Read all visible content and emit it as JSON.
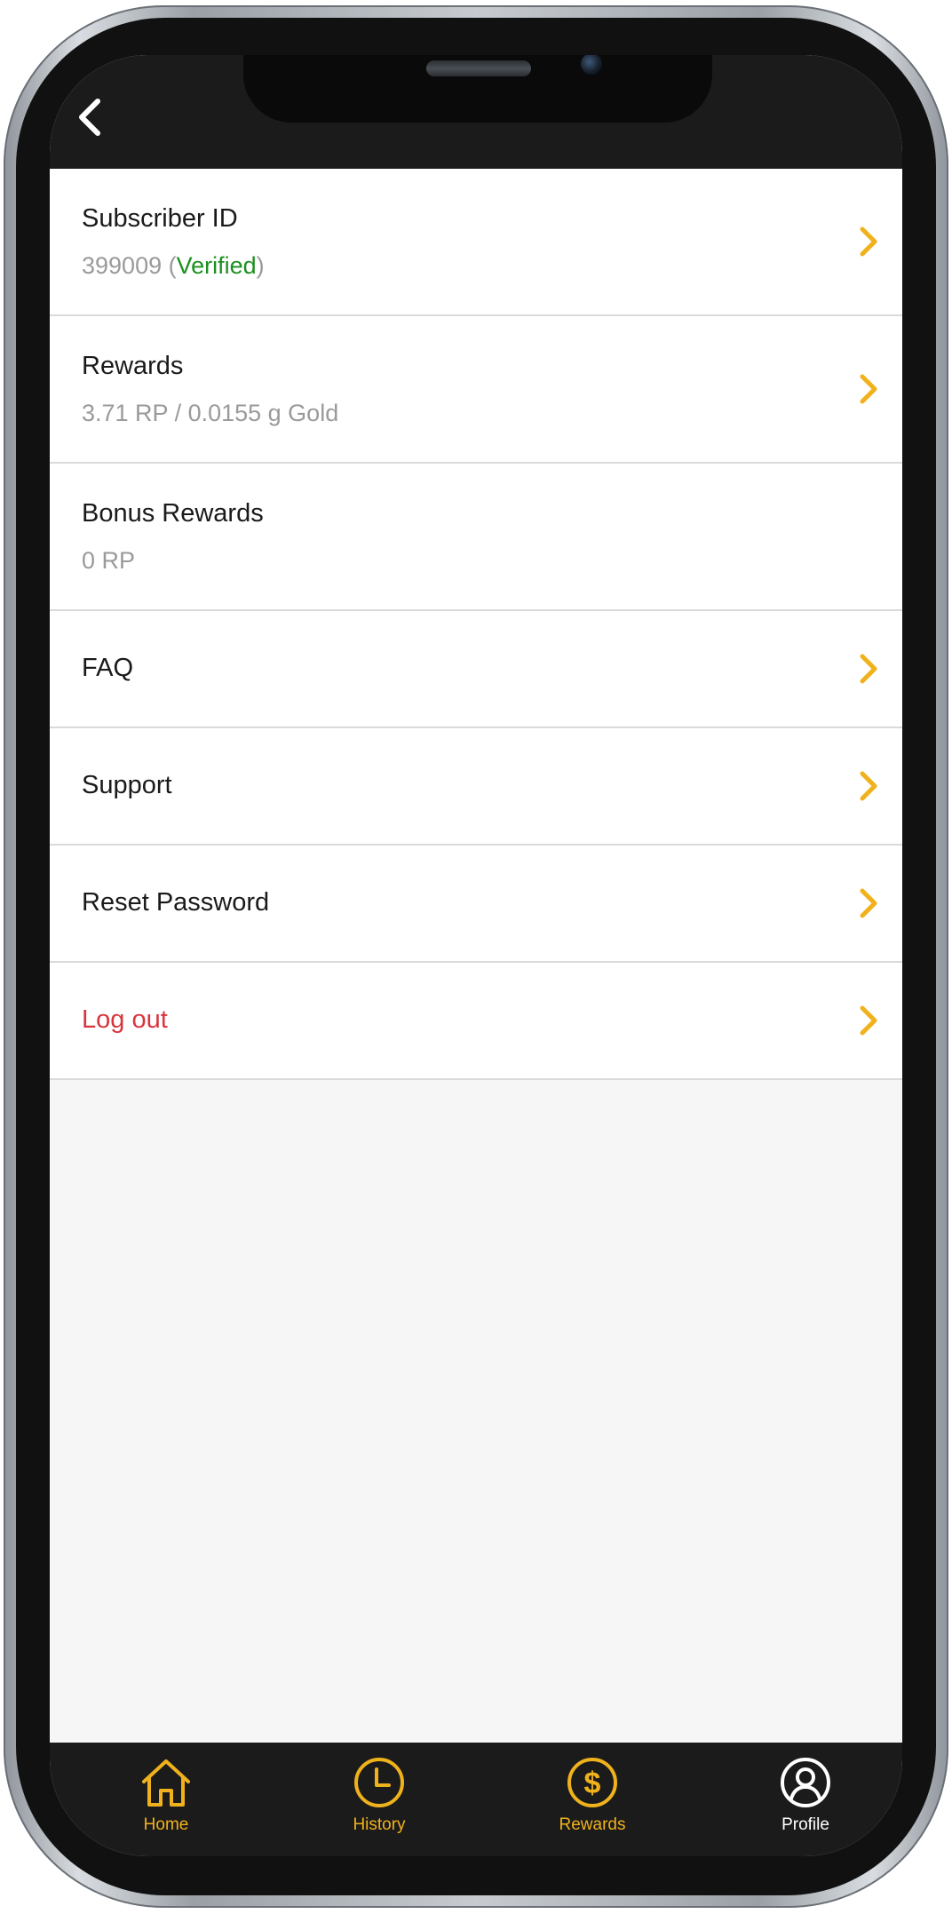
{
  "colors": {
    "accent": "#f0b21c",
    "verified": "#1d8f20",
    "logout": "#d8353d",
    "header_bg": "#1c1b1b"
  },
  "header": {
    "back_icon": "chevron-left-icon"
  },
  "menu": {
    "subscriber": {
      "title": "Subscriber ID",
      "value": "399009",
      "status_open": " (",
      "status": "Verified",
      "status_close": ")"
    },
    "rewards": {
      "title": "Rewards",
      "value": "3.71 RP / 0.0155 g Gold"
    },
    "bonus_rewards": {
      "title": "Bonus Rewards",
      "value": "0 RP"
    },
    "faq": {
      "title": "FAQ"
    },
    "support": {
      "title": "Support"
    },
    "reset_password": {
      "title": "Reset Password"
    },
    "logout": {
      "title": "Log out"
    }
  },
  "tabs": {
    "home": {
      "label": "Home",
      "icon": "home-icon"
    },
    "history": {
      "label": "History",
      "icon": "clock-icon"
    },
    "rewards": {
      "label": "Rewards",
      "icon": "dollar-icon"
    },
    "profile": {
      "label": "Profile",
      "icon": "user-icon",
      "active": true
    }
  }
}
